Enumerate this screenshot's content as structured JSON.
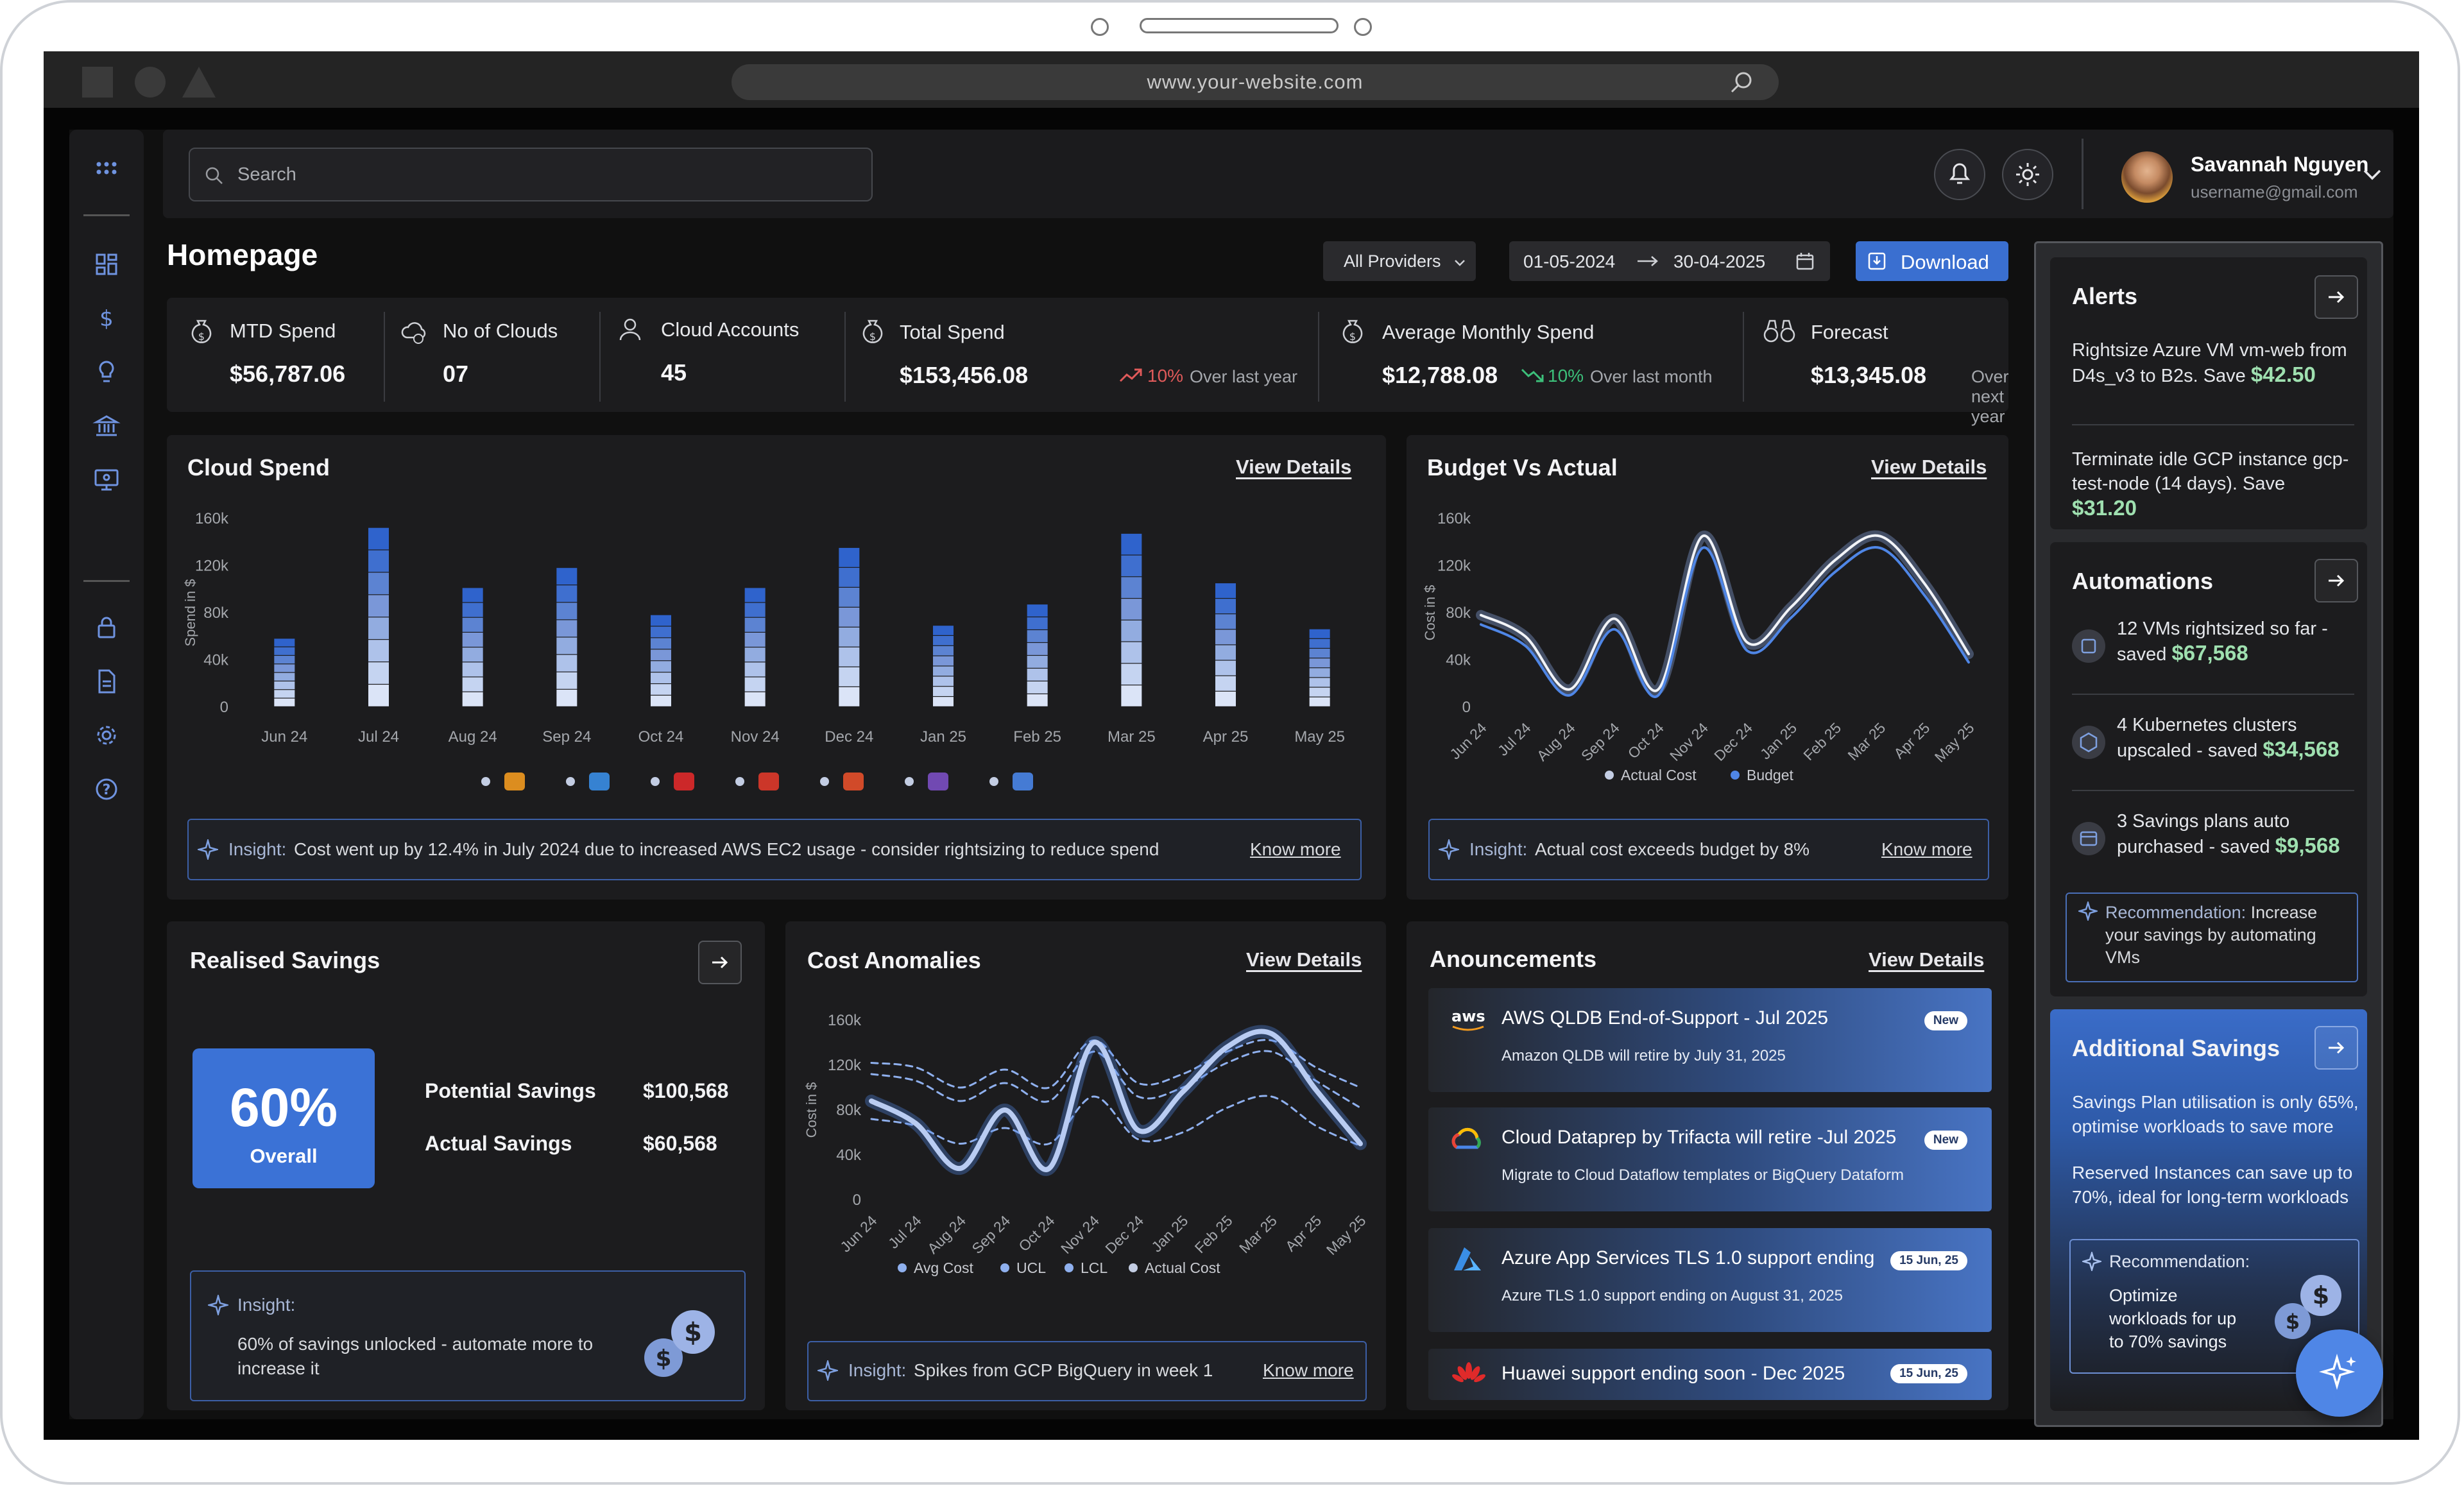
{
  "browser": {
    "url": "www.your-website.com"
  },
  "search": {
    "placeholder": "Search"
  },
  "user": {
    "name": "Savannah Nguyen",
    "email": "username@gmail.com"
  },
  "page": {
    "title": "Homepage",
    "provider_filter": "All Providers",
    "date_from": "01-05-2024",
    "date_to": "30-04-2025",
    "download_label": "Download"
  },
  "stats": {
    "mtd": {
      "label": "MTD Spend",
      "value": "$56,787.06"
    },
    "clouds": {
      "label": "No of Clouds",
      "value": "07"
    },
    "accounts": {
      "label": "Cloud Accounts",
      "value": "45"
    },
    "total": {
      "label": "Total Spend",
      "value": "$153,456.08",
      "change": "10%",
      "sub": "Over last year"
    },
    "avg": {
      "label": "Average Monthly Spend",
      "value": "$12,788.08",
      "change": "10%",
      "sub": "Over last month"
    },
    "forecast": {
      "label": "Forecast",
      "value": "$13,345.08",
      "sub": "Over next year"
    }
  },
  "colors": {
    "accent": "#3a6fd0",
    "up": "#e05a5a",
    "down": "#3cc07a",
    "panel": "#1c1c1e"
  },
  "cloud_spend": {
    "title": "Cloud Spend",
    "link": "View Details",
    "insight_label": "Insight:",
    "insight": "Cost went up by 12.4% in July 2024 due to increased AWS EC2 usage - consider rightsizing to reduce spend",
    "know_more": "Know more",
    "legend_icons": [
      "aws-icon",
      "azure-icon",
      "huawei-icon",
      "oracle-icon",
      "databricks-icon",
      "heroku-icon",
      "gcp-icon"
    ]
  },
  "budget": {
    "title": "Budget Vs Actual",
    "link": "View Details",
    "insight_label": "Insight:",
    "insight": "Actual cost exceeds budget by 8%",
    "know_more": "Know more"
  },
  "savings": {
    "title": "Realised Savings",
    "percent": "60%",
    "overall": "Overall",
    "potential_label": "Potential Savings",
    "potential_value": "$100,568",
    "actual_label": "Actual Savings",
    "actual_value": "$60,568",
    "insight_label": "Insight:",
    "insight": "60% of savings unlocked - automate more to increase it"
  },
  "anomalies": {
    "title": "Cost Anomalies",
    "link": "View Details",
    "insight_label": "Insight:",
    "insight": "Spikes from GCP BigQuery in week 1",
    "know_more": "Know more"
  },
  "announcements": {
    "title": "Anouncements",
    "link": "View Details",
    "items": [
      {
        "icon": "aws-icon",
        "title": "AWS QLDB End-of-Support - Jul 2025",
        "sub": "Amazon QLDB will retire by July 31, 2025",
        "badge": "New"
      },
      {
        "icon": "gcp-icon",
        "title": "Cloud Dataprep by Trifacta will retire -Jul 2025",
        "sub": "Migrate to Cloud Dataflow templates or BigQuery Dataform",
        "badge": "New"
      },
      {
        "icon": "azure-icon",
        "title": "Azure App Services TLS 1.0 support ending",
        "sub": "Azure TLS 1.0 support ending on August 31, 2025",
        "badge": "15 Jun, 25"
      },
      {
        "icon": "huawei-icon",
        "title": "Huawei support ending soon - Dec 2025",
        "sub": "",
        "badge": "15 Jun, 25"
      }
    ]
  },
  "alerts": {
    "title": "Alerts",
    "items": [
      {
        "text": "Rightsize Azure VM vm-web from D4s_v3 to B2s. Save",
        "amount": "$42.50"
      },
      {
        "text": "Terminate idle GCP instance gcp-test-node (14 days). Save",
        "amount": "$31.20"
      }
    ]
  },
  "automations": {
    "title": "Automations",
    "items": [
      {
        "text": "12 VMs rightsized so far - saved",
        "amount": "$67,568"
      },
      {
        "text": "4 Kubernetes clusters upscaled - saved",
        "amount": "$34,568"
      },
      {
        "text": "3 Savings plans auto purchased - saved",
        "amount": "$9,568"
      }
    ],
    "rec_label": "Recommendation:",
    "rec": "Increase your savings by automating VMs"
  },
  "additional": {
    "title": "Additional Savings",
    "p1": "Savings Plan utilisation is only 65%, optimise workloads to save more",
    "p2": "Reserved Instances can save up to 70%, ideal for long-term workloads",
    "rec_label": "Recommendation:",
    "rec": "Optimize workloads for up to 70% savings"
  },
  "chart_data": [
    {
      "type": "bar",
      "title": "Cloud Spend",
      "ylabel": "Spend in $",
      "ylim": [
        0,
        160000
      ],
      "yticks": [
        "160k",
        "120k",
        "80k",
        "40k",
        "0"
      ],
      "categories": [
        "Jun 24",
        "Jul 24",
        "Aug 24",
        "Sep 24",
        "Oct 24",
        "Nov 24",
        "Dec 24",
        "Jan 25",
        "Feb 25",
        "Mar 25",
        "Apr 25",
        "May 25"
      ],
      "values": [
        58000,
        152000,
        101000,
        118000,
        78000,
        101000,
        135000,
        69000,
        87000,
        147000,
        105000,
        66000
      ]
    },
    {
      "type": "line",
      "title": "Budget Vs Actual",
      "ylabel": "Cost in $",
      "ylim": [
        0,
        160000
      ],
      "yticks": [
        "160k",
        "120k",
        "80k",
        "40k",
        "0"
      ],
      "categories": [
        "Jun 24",
        "Jul 24",
        "Aug 24",
        "Sep 24",
        "Oct 24",
        "Nov 24",
        "Dec 24",
        "Jan 25",
        "Feb 25",
        "Mar 25",
        "Apr 25",
        "May 25"
      ],
      "series": [
        {
          "name": "Actual Cost",
          "values": [
            78000,
            60000,
            15000,
            75000,
            15000,
            145000,
            55000,
            85000,
            125000,
            145000,
            105000,
            45000
          ]
        },
        {
          "name": "Budget",
          "values": [
            70000,
            52000,
            10000,
            66000,
            10000,
            135000,
            48000,
            76000,
            115000,
            135000,
            95000,
            38000
          ]
        }
      ],
      "legend": "bottom"
    },
    {
      "type": "line",
      "title": "Cost Anomalies",
      "ylabel": "Cost in $",
      "ylim": [
        0,
        160000
      ],
      "yticks": [
        "160k",
        "120k",
        "80k",
        "40k",
        "0"
      ],
      "categories": [
        "Jun 24",
        "Jul 24",
        "Aug 24",
        "Sep 24",
        "Oct 24",
        "Nov 24",
        "Dec 24",
        "Jan 25",
        "Feb 25",
        "Mar 25",
        "Apr 25",
        "May 25"
      ],
      "series": [
        {
          "name": "Avg Cost",
          "values": [
            122000,
            118000,
            100000,
            116000,
            100000,
            142000,
            104000,
            112000,
            132000,
            142000,
            118000,
            100000
          ]
        },
        {
          "name": "UCL",
          "values": [
            112000,
            106000,
            88000,
            104000,
            88000,
            132000,
            92000,
            100000,
            122000,
            132000,
            106000,
            82000
          ]
        },
        {
          "name": "LCL",
          "values": [
            72000,
            66000,
            50000,
            64000,
            50000,
            92000,
            54000,
            60000,
            82000,
            92000,
            66000,
            48000
          ]
        },
        {
          "name": "Actual Cost",
          "values": [
            88000,
            68000,
            28000,
            80000,
            28000,
            140000,
            62000,
            96000,
            136000,
            148000,
            98000,
            50000
          ]
        }
      ],
      "legend": "bottom"
    }
  ]
}
